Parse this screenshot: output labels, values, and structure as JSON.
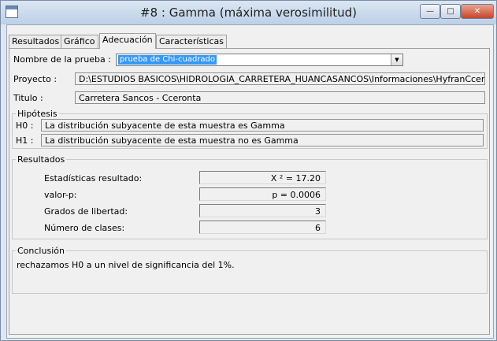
{
  "window": {
    "title": "#8 : Gamma (máxima verosimilitud)",
    "buttons": {
      "minimize": "—",
      "maximize": "□",
      "close": "✕"
    }
  },
  "tabs": [
    {
      "label": "Resultados"
    },
    {
      "label": "Gráfico"
    },
    {
      "label": "Adecuación",
      "active": true
    },
    {
      "label": "Características"
    }
  ],
  "form": {
    "test_label": "Nombre de la prueba :",
    "test_value": "prueba de Chi-cuadrado",
    "project_label": "Proyecto :",
    "project_value": "D:\\ESTUDIOS BASICOS\\HIDROLOGIA_CARRETERA_HUANCASANCOS\\Informaciones\\HyfranCceronta.",
    "title_label": "Titulo :",
    "title_value": "Carretera Sancos - Cceronta"
  },
  "hypotheses": {
    "legend": "Hipótesis",
    "h0_label": "H0 :",
    "h0_value": "La distribución subyacente de esta muestra es Gamma",
    "h1_label": "H1 :",
    "h1_value": "La distribución subyacente de esta muestra no es Gamma"
  },
  "results": {
    "legend": "Resultados",
    "rows": [
      {
        "label": "Estadísticas resultado:",
        "value": "X ² = 17.20"
      },
      {
        "label": "valor-p:",
        "value": "p = 0.0006"
      },
      {
        "label": "Grados de libertad:",
        "value": "3"
      },
      {
        "label": "Número de clases:",
        "value": "6"
      }
    ]
  },
  "conclusion": {
    "legend": "Conclusión",
    "text": "rechazamos H0 a un nivel de significancia del 1%."
  }
}
